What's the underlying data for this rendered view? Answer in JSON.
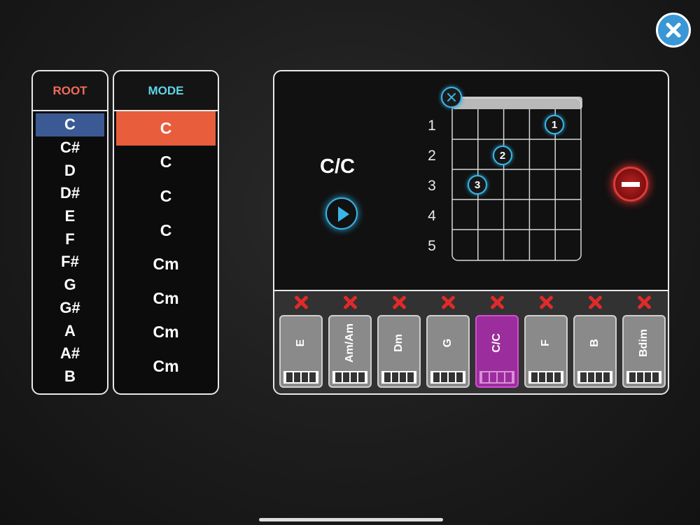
{
  "root": {
    "header": "ROOT",
    "header_color": "#f26b5b",
    "items": [
      "C",
      "C#",
      "D",
      "D#",
      "E",
      "F",
      "F#",
      "G",
      "G#",
      "A",
      "A#",
      "B"
    ],
    "selected": "C"
  },
  "mode": {
    "header": "MODE",
    "header_color": "#5fd4e6",
    "items": [
      "C",
      "C",
      "C",
      "C",
      "Cm",
      "Cm",
      "Cm",
      "Cm"
    ],
    "selected_index": 0
  },
  "chord": {
    "name": "C/C",
    "frets": [
      "1",
      "2",
      "3",
      "4",
      "5"
    ],
    "fingers": [
      "1",
      "2",
      "3"
    ]
  },
  "progression": [
    "E",
    "Am/Am",
    "Dm",
    "G",
    "C/C",
    "F",
    "B",
    "Bdim"
  ],
  "active_progression_index": 4,
  "colors": {
    "accent": "#39b6e6",
    "selection_root": "#3b5a93",
    "selection_mode": "#e85d3b",
    "active_chord": "#9c2d9c",
    "delete": "#e02a2a"
  },
  "icons": {
    "close": "close-icon",
    "play": "play-icon",
    "remove": "remove-icon",
    "mute": "mute-string-icon",
    "delete": "delete-x-icon"
  }
}
